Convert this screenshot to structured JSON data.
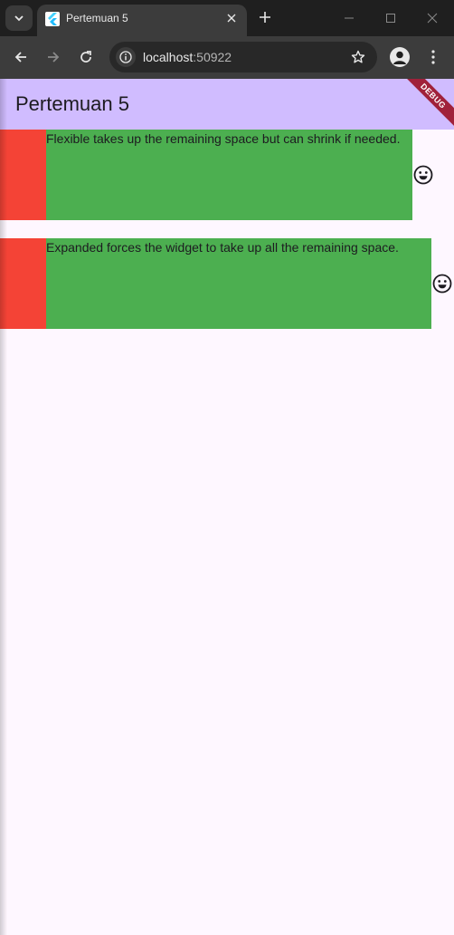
{
  "browser": {
    "tab_title": "Pertemuan 5",
    "url_host": "localhost",
    "url_port": ":50922"
  },
  "app": {
    "title": "Pertemuan 5",
    "debug_label": "DEBUG",
    "rows": [
      {
        "text": "Flexible takes up the remaining space but can shrink if needed."
      },
      {
        "text": "Expanded forces the widget to take up all the remaining space."
      }
    ]
  },
  "colors": {
    "appbar": "#d0bcff",
    "background": "#fef7ff",
    "red": "#f44336",
    "green": "#4caf50"
  }
}
